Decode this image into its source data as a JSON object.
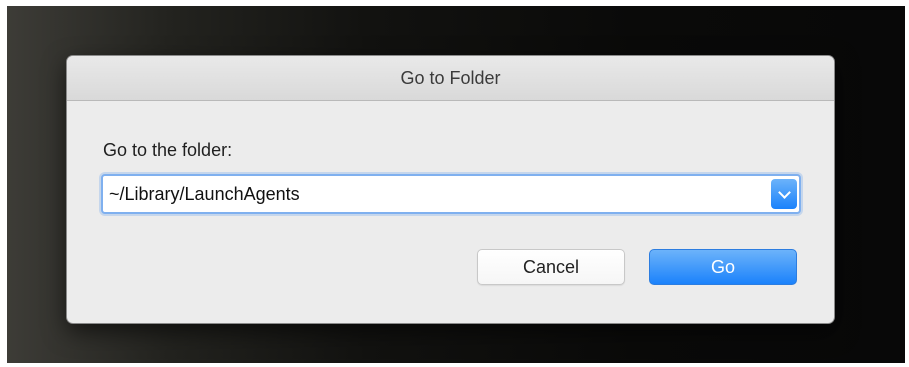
{
  "dialog": {
    "title": "Go to Folder",
    "prompt": "Go to the folder:",
    "path_value": "~/Library/LaunchAgents",
    "dropdown_icon": "chevron-down-icon",
    "buttons": {
      "cancel_label": "Cancel",
      "go_label": "Go"
    }
  },
  "colors": {
    "accent": "#1a82fb",
    "dialog_bg": "#ececec",
    "focus_ring": "#7fb0ef"
  }
}
